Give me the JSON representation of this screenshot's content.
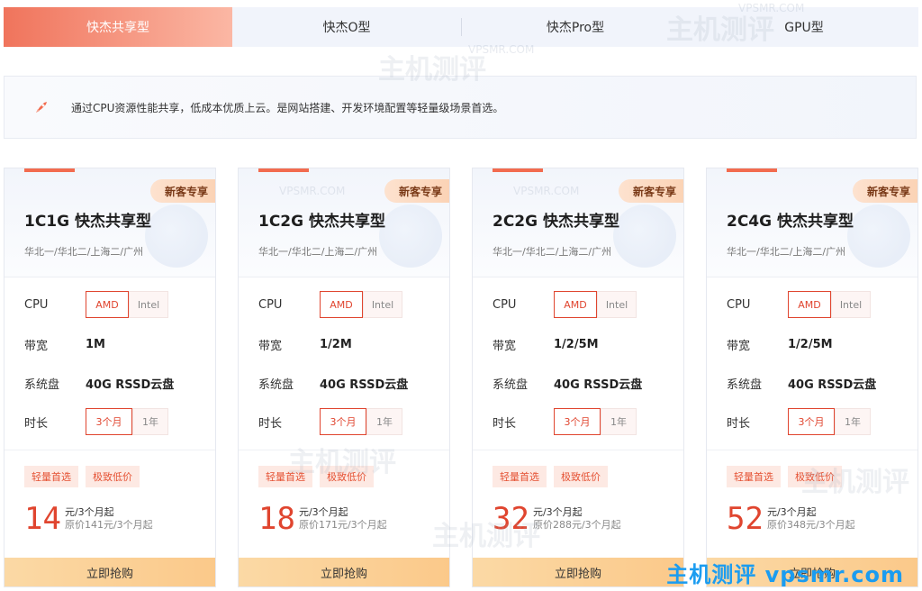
{
  "tabs": [
    {
      "label": "快杰共享型",
      "active": true
    },
    {
      "label": "快杰O型",
      "active": false
    },
    {
      "label": "快杰Pro型",
      "active": false
    },
    {
      "label": "GPU型",
      "active": false
    }
  ],
  "description": {
    "icon": "rocket-icon",
    "text": "通过CPU资源性能共享，低成本优质上云。是网站搭建、开发环境配置等轻量级场景首选。"
  },
  "labels": {
    "cpu": "CPU",
    "bandwidth": "带宽",
    "disk": "系统盘",
    "duration": "时长",
    "buy": "立即抢购",
    "badge": "新客专享"
  },
  "cards": [
    {
      "title": "1C1G 快杰共享型",
      "region": "华北一/华北二/上海二/广州",
      "cpu_options": [
        "AMD",
        "Intel"
      ],
      "bandwidth": "1M",
      "disk": "40G RSSD云盘",
      "durations": [
        "3个月",
        "1年"
      ],
      "tags": [
        "轻量首选",
        "极致低价"
      ],
      "price": "14",
      "unit": "元/3个月起",
      "orig": "原价141元/3个月起"
    },
    {
      "title": "1C2G 快杰共享型",
      "region": "华北一/华北二/上海二/广州",
      "cpu_options": [
        "AMD",
        "Intel"
      ],
      "bandwidth": "1/2M",
      "disk": "40G RSSD云盘",
      "durations": [
        "3个月",
        "1年"
      ],
      "tags": [
        "轻量首选",
        "极致低价"
      ],
      "price": "18",
      "unit": "元/3个月起",
      "orig": "原价171元/3个月起"
    },
    {
      "title": "2C2G 快杰共享型",
      "region": "华北一/华北二/上海二/广州",
      "cpu_options": [
        "AMD",
        "Intel"
      ],
      "bandwidth": "1/2/5M",
      "disk": "40G RSSD云盘",
      "durations": [
        "3个月",
        "1年"
      ],
      "tags": [
        "轻量首选",
        "极致低价"
      ],
      "price": "32",
      "unit": "元/3个月起",
      "orig": "原价288元/3个月起"
    },
    {
      "title": "2C4G 快杰共享型",
      "region": "华北一/华北二/上海二/广州",
      "cpu_options": [
        "AMD",
        "Intel"
      ],
      "bandwidth": "1/2/5M",
      "disk": "40G RSSD云盘",
      "durations": [
        "3个月",
        "1年"
      ],
      "tags": [
        "轻量首选",
        "极致低价"
      ],
      "price": "52",
      "unit": "元/3个月起",
      "orig": "原价348元/3个月起"
    }
  ],
  "watermark": {
    "cn": "主机测评",
    "en": "VPSMR.COM"
  },
  "brand": "主机测评 vpsmr.com",
  "colors": {
    "accent": "#e0452f",
    "brand": "#1b9cf0"
  }
}
